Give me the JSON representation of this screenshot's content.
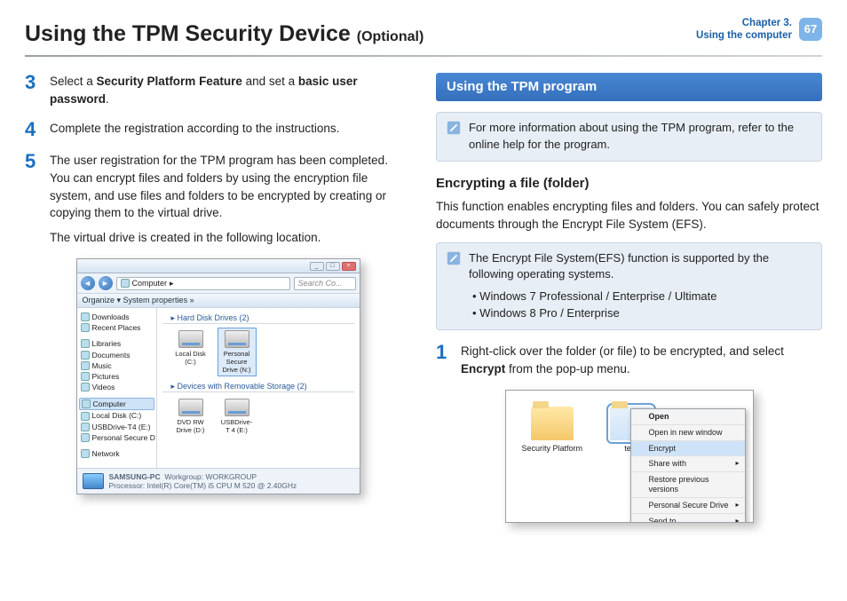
{
  "header": {
    "title": "Using the TPM Security Device",
    "optional": "(Optional)",
    "chapter_line1": "Chapter 3.",
    "chapter_line2": "Using the computer",
    "page_number": "67"
  },
  "left": {
    "step3": {
      "num": "3",
      "text_pre": "Select a ",
      "bold1": "Security Platform Feature",
      "mid": " and set a ",
      "bold2": "basic user password",
      "post": "."
    },
    "step4": {
      "num": "4",
      "text": "Complete the registration according to the instructions."
    },
    "step5": {
      "num": "5",
      "p1": "The user registration for the TPM program has been completed. You can encrypt files and folders by using the encryption file system, and use files and folders to be encrypted by creating or copying them to the virtual drive.",
      "p2": "The virtual drive is created in the following location."
    },
    "explorer": {
      "address_icon_label": "Computer",
      "address_path": "▸",
      "search_placeholder": "Search Co...",
      "toolbar": "Organize ▾     System properties      »",
      "nav": {
        "downloads": "Downloads",
        "recent": "Recent Places",
        "libraries": "Libraries",
        "documents": "Documents",
        "music": "Music",
        "pictures": "Pictures",
        "videos": "Videos",
        "computer": "Computer",
        "localdisk": "Local Disk (C:)",
        "usbdrive": "USBDrive-T4 (E:)",
        "psd": "Personal Secure D",
        "network": "Network"
      },
      "content": {
        "hdd_label": "▸ Hard Disk Drives (2)",
        "drive1": "Local Disk (C:)",
        "drive2": "Personal Secure Drive (N:)",
        "removable_label": "▸ Devices with Removable Storage (2)",
        "drive3": "DVD RW Drive (D:)",
        "drive4": "USBDrive-T 4 (E:)"
      },
      "status": {
        "pc_name": "SAMSUNG-PC",
        "workgroup_label": "Workgroup:",
        "workgroup": "WORKGROUP",
        "proc_label": "Processor:",
        "proc": "Intel(R) Core(TM) i5 CPU     M 520  @ 2.40GHz"
      }
    }
  },
  "right": {
    "section_banner": "Using the TPM program",
    "info1": "For more information about using the TPM program, refer to the online help for the program.",
    "sub_heading": "Encrypting a file (folder)",
    "para1": "This function enables encrypting files and folders. You can safely protect documents through the Encrypt File System (EFS).",
    "info2": {
      "lead": "The Encrypt File System(EFS) function is supported by the following operating systems.",
      "li1": "Windows 7 Professional / Enterprise / Ultimate",
      "li2": "Windows 8 Pro / Enterprise"
    },
    "step1": {
      "num": "1",
      "pre": "Right-click over the folder (or file) to be encrypted, and select ",
      "bold": "Encrypt",
      "post": " from the pop-up menu."
    },
    "ctx_shot": {
      "folder1": "Security Platform",
      "folder2": "test",
      "menu": {
        "open": "Open",
        "open_new": "Open in new window",
        "encrypt": "Encrypt",
        "share": "Share with",
        "restore": "Restore previous versions",
        "psd": "Personal Secure Drive",
        "sendto": "Send to"
      }
    }
  }
}
